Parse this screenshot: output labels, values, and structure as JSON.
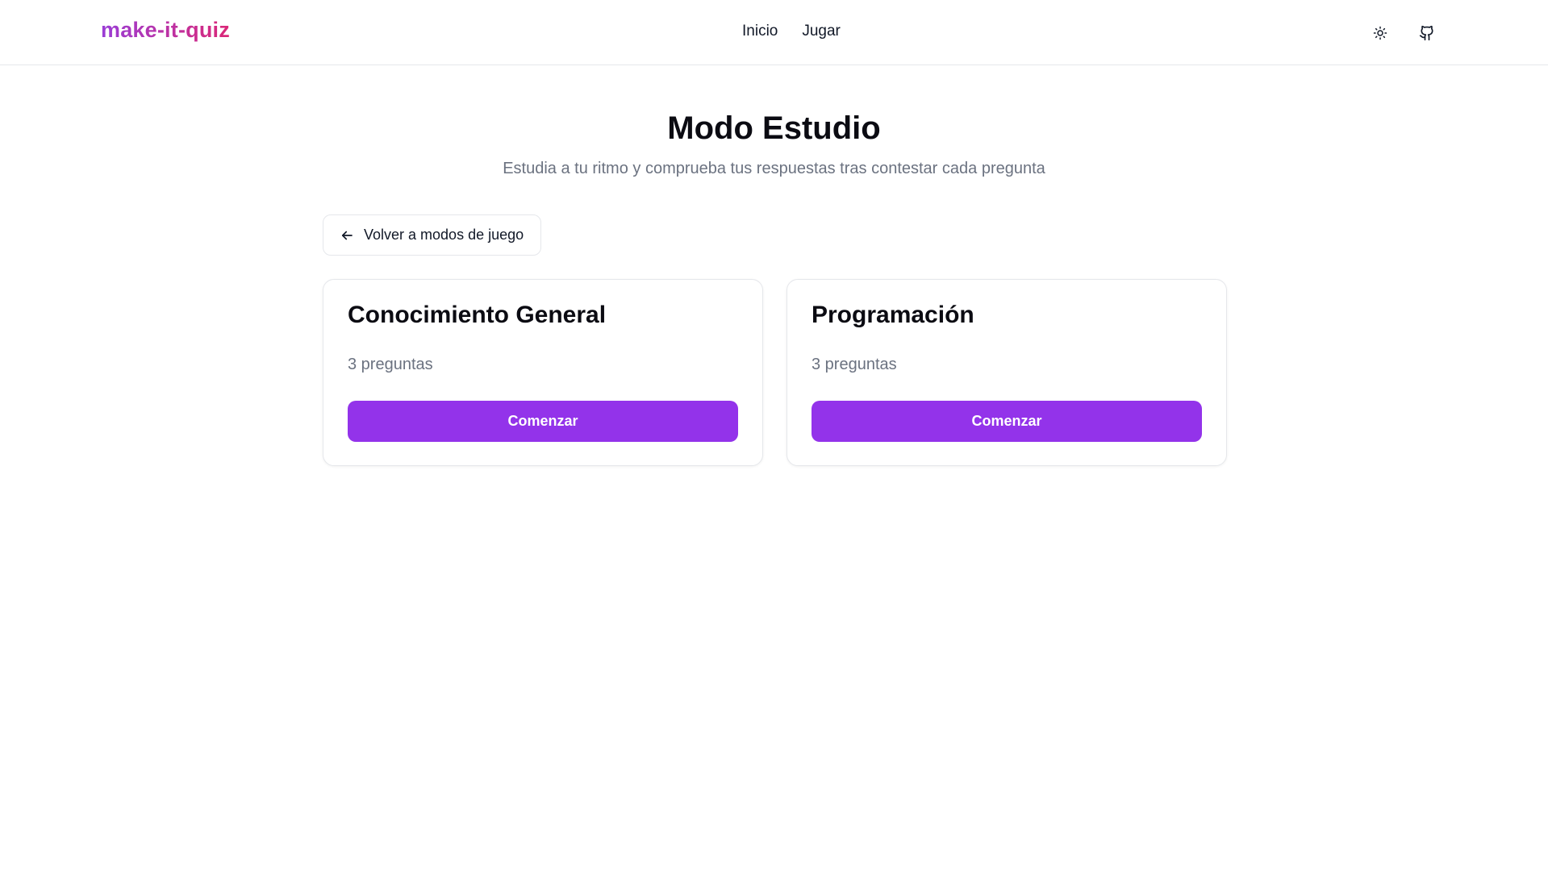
{
  "header": {
    "logo": "make-it-quiz",
    "nav": [
      {
        "label": "Inicio"
      },
      {
        "label": "Jugar"
      }
    ],
    "theme_icon": "sun-icon",
    "github_icon": "github-icon"
  },
  "hero": {
    "title": "Modo Estudio",
    "subtitle": "Estudia a tu ritmo y comprueba tus respuestas tras contestar cada pregunta"
  },
  "back": {
    "label": "Volver a modos de juego",
    "icon": "arrow-left-icon"
  },
  "quizzes": [
    {
      "title": "Conocimiento General",
      "count": "3 preguntas",
      "button": "Comenzar"
    },
    {
      "title": "Programación",
      "count": "3 preguntas",
      "button": "Comenzar"
    }
  ],
  "colors": {
    "accent": "#9333ea",
    "logo_gradient_start": "#9a3dd6",
    "logo_gradient_end": "#db2777",
    "muted_text": "#6b7280",
    "border": "#e5e7eb"
  }
}
